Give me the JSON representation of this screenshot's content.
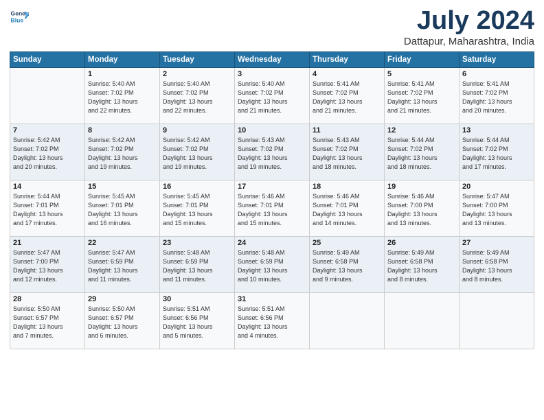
{
  "header": {
    "logo_line1": "General",
    "logo_line2": "Blue",
    "month_year": "July 2024",
    "location": "Dattapur, Maharashtra, India"
  },
  "days_of_week": [
    "Sunday",
    "Monday",
    "Tuesday",
    "Wednesday",
    "Thursday",
    "Friday",
    "Saturday"
  ],
  "weeks": [
    [
      {
        "day": "",
        "detail": ""
      },
      {
        "day": "1",
        "detail": "Sunrise: 5:40 AM\nSunset: 7:02 PM\nDaylight: 13 hours\nand 22 minutes."
      },
      {
        "day": "2",
        "detail": "Sunrise: 5:40 AM\nSunset: 7:02 PM\nDaylight: 13 hours\nand 22 minutes."
      },
      {
        "day": "3",
        "detail": "Sunrise: 5:40 AM\nSunset: 7:02 PM\nDaylight: 13 hours\nand 21 minutes."
      },
      {
        "day": "4",
        "detail": "Sunrise: 5:41 AM\nSunset: 7:02 PM\nDaylight: 13 hours\nand 21 minutes."
      },
      {
        "day": "5",
        "detail": "Sunrise: 5:41 AM\nSunset: 7:02 PM\nDaylight: 13 hours\nand 21 minutes."
      },
      {
        "day": "6",
        "detail": "Sunrise: 5:41 AM\nSunset: 7:02 PM\nDaylight: 13 hours\nand 20 minutes."
      }
    ],
    [
      {
        "day": "7",
        "detail": "Sunrise: 5:42 AM\nSunset: 7:02 PM\nDaylight: 13 hours\nand 20 minutes."
      },
      {
        "day": "8",
        "detail": "Sunrise: 5:42 AM\nSunset: 7:02 PM\nDaylight: 13 hours\nand 19 minutes."
      },
      {
        "day": "9",
        "detail": "Sunrise: 5:42 AM\nSunset: 7:02 PM\nDaylight: 13 hours\nand 19 minutes."
      },
      {
        "day": "10",
        "detail": "Sunrise: 5:43 AM\nSunset: 7:02 PM\nDaylight: 13 hours\nand 19 minutes."
      },
      {
        "day": "11",
        "detail": "Sunrise: 5:43 AM\nSunset: 7:02 PM\nDaylight: 13 hours\nand 18 minutes."
      },
      {
        "day": "12",
        "detail": "Sunrise: 5:44 AM\nSunset: 7:02 PM\nDaylight: 13 hours\nand 18 minutes."
      },
      {
        "day": "13",
        "detail": "Sunrise: 5:44 AM\nSunset: 7:02 PM\nDaylight: 13 hours\nand 17 minutes."
      }
    ],
    [
      {
        "day": "14",
        "detail": "Sunrise: 5:44 AM\nSunset: 7:01 PM\nDaylight: 13 hours\nand 17 minutes."
      },
      {
        "day": "15",
        "detail": "Sunrise: 5:45 AM\nSunset: 7:01 PM\nDaylight: 13 hours\nand 16 minutes."
      },
      {
        "day": "16",
        "detail": "Sunrise: 5:45 AM\nSunset: 7:01 PM\nDaylight: 13 hours\nand 15 minutes."
      },
      {
        "day": "17",
        "detail": "Sunrise: 5:46 AM\nSunset: 7:01 PM\nDaylight: 13 hours\nand 15 minutes."
      },
      {
        "day": "18",
        "detail": "Sunrise: 5:46 AM\nSunset: 7:01 PM\nDaylight: 13 hours\nand 14 minutes."
      },
      {
        "day": "19",
        "detail": "Sunrise: 5:46 AM\nSunset: 7:00 PM\nDaylight: 13 hours\nand 13 minutes."
      },
      {
        "day": "20",
        "detail": "Sunrise: 5:47 AM\nSunset: 7:00 PM\nDaylight: 13 hours\nand 13 minutes."
      }
    ],
    [
      {
        "day": "21",
        "detail": "Sunrise: 5:47 AM\nSunset: 7:00 PM\nDaylight: 13 hours\nand 12 minutes."
      },
      {
        "day": "22",
        "detail": "Sunrise: 5:47 AM\nSunset: 6:59 PM\nDaylight: 13 hours\nand 11 minutes."
      },
      {
        "day": "23",
        "detail": "Sunrise: 5:48 AM\nSunset: 6:59 PM\nDaylight: 13 hours\nand 11 minutes."
      },
      {
        "day": "24",
        "detail": "Sunrise: 5:48 AM\nSunset: 6:59 PM\nDaylight: 13 hours\nand 10 minutes."
      },
      {
        "day": "25",
        "detail": "Sunrise: 5:49 AM\nSunset: 6:58 PM\nDaylight: 13 hours\nand 9 minutes."
      },
      {
        "day": "26",
        "detail": "Sunrise: 5:49 AM\nSunset: 6:58 PM\nDaylight: 13 hours\nand 8 minutes."
      },
      {
        "day": "27",
        "detail": "Sunrise: 5:49 AM\nSunset: 6:58 PM\nDaylight: 13 hours\nand 8 minutes."
      }
    ],
    [
      {
        "day": "28",
        "detail": "Sunrise: 5:50 AM\nSunset: 6:57 PM\nDaylight: 13 hours\nand 7 minutes."
      },
      {
        "day": "29",
        "detail": "Sunrise: 5:50 AM\nSunset: 6:57 PM\nDaylight: 13 hours\nand 6 minutes."
      },
      {
        "day": "30",
        "detail": "Sunrise: 5:51 AM\nSunset: 6:56 PM\nDaylight: 13 hours\nand 5 minutes."
      },
      {
        "day": "31",
        "detail": "Sunrise: 5:51 AM\nSunset: 6:56 PM\nDaylight: 13 hours\nand 4 minutes."
      },
      {
        "day": "",
        "detail": ""
      },
      {
        "day": "",
        "detail": ""
      },
      {
        "day": "",
        "detail": ""
      }
    ]
  ]
}
